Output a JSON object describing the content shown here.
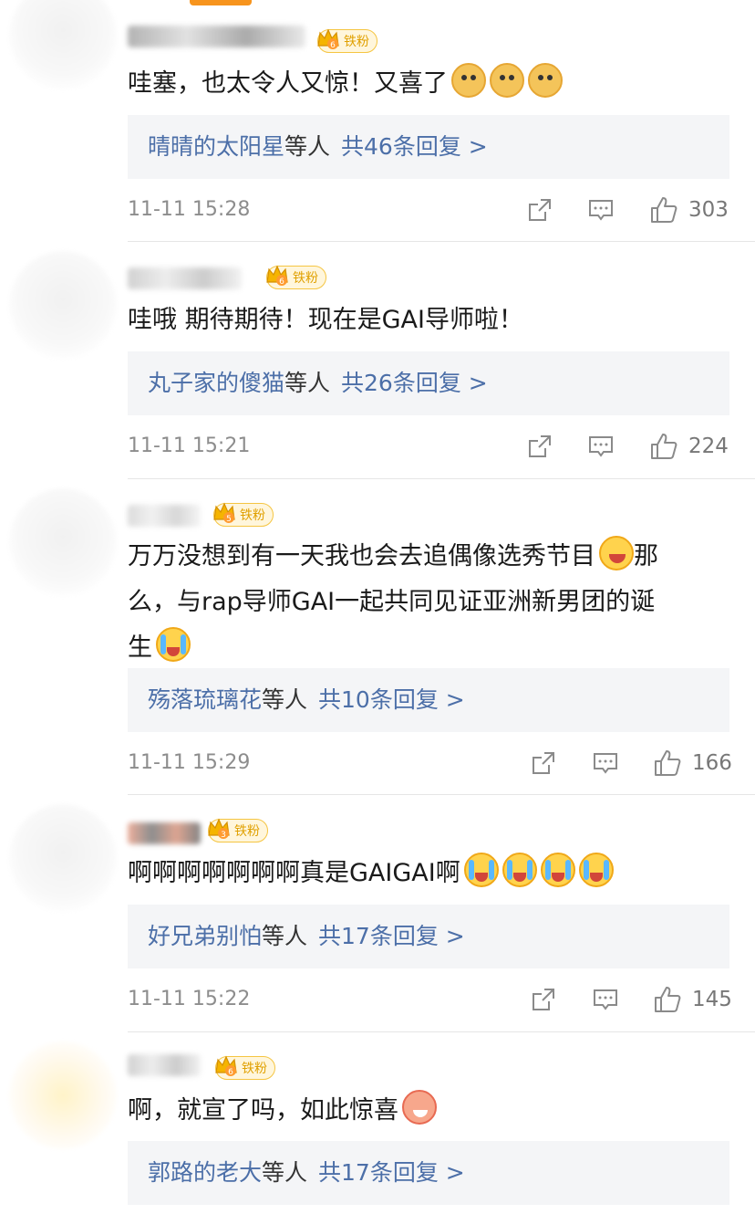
{
  "badge_label": "铁粉",
  "colors": {
    "link": "#4c6fa8",
    "badge": "#f5c542",
    "top_tab_indicator": "#f7941d"
  },
  "comments": [
    {
      "badge_level": "6",
      "text": "哇塞，也太令人又惊！又喜了",
      "emojis": [
        "doge",
        "doge",
        "doge"
      ],
      "reply_names": "晴晴的太阳星",
      "reply_etc": "等人",
      "reply_count": "共46条回复 >",
      "time": "11-11 15:28",
      "likes": "303"
    },
    {
      "badge_level": "6",
      "text": "哇哦 期待期待！现在是GAI导师啦！",
      "emojis": [],
      "reply_names": "丸子家的傻猫",
      "reply_etc": "等人",
      "reply_count": "共26条回复 >",
      "time": "11-11 15:21",
      "likes": "224"
    },
    {
      "badge_level": "5",
      "text_line1": "万万没想到有一天我也会去追偶像选秀节目",
      "text_line1_tail": "那",
      "text_line2": "么，与rap导师GAI一起共同见证亚洲新男团的诞",
      "text_line3": "生",
      "emojis": [
        "laugh",
        "tears"
      ],
      "reply_names": "殇落琉璃花",
      "reply_etc": "等人",
      "reply_count": "共10条回复 >",
      "time": "11-11 15:29",
      "likes": "166"
    },
    {
      "badge_level": "3",
      "text": "啊啊啊啊啊啊啊真是GAIGAI啊",
      "emojis": [
        "tears",
        "tears",
        "tears",
        "tears"
      ],
      "reply_names": "好兄弟别怕",
      "reply_etc": "等人",
      "reply_count": "共17条回复 >",
      "time": "11-11 15:22",
      "likes": "145"
    },
    {
      "badge_level": "6",
      "text": "啊，就宣了吗，如此惊喜",
      "emojis": [
        "cute"
      ],
      "reply_names": "郭路的老大",
      "reply_etc": "等人",
      "reply_count": "共17条回复 >"
    }
  ],
  "icons": [
    "share-icon",
    "comment-icon",
    "like-icon",
    "crown-icon"
  ]
}
